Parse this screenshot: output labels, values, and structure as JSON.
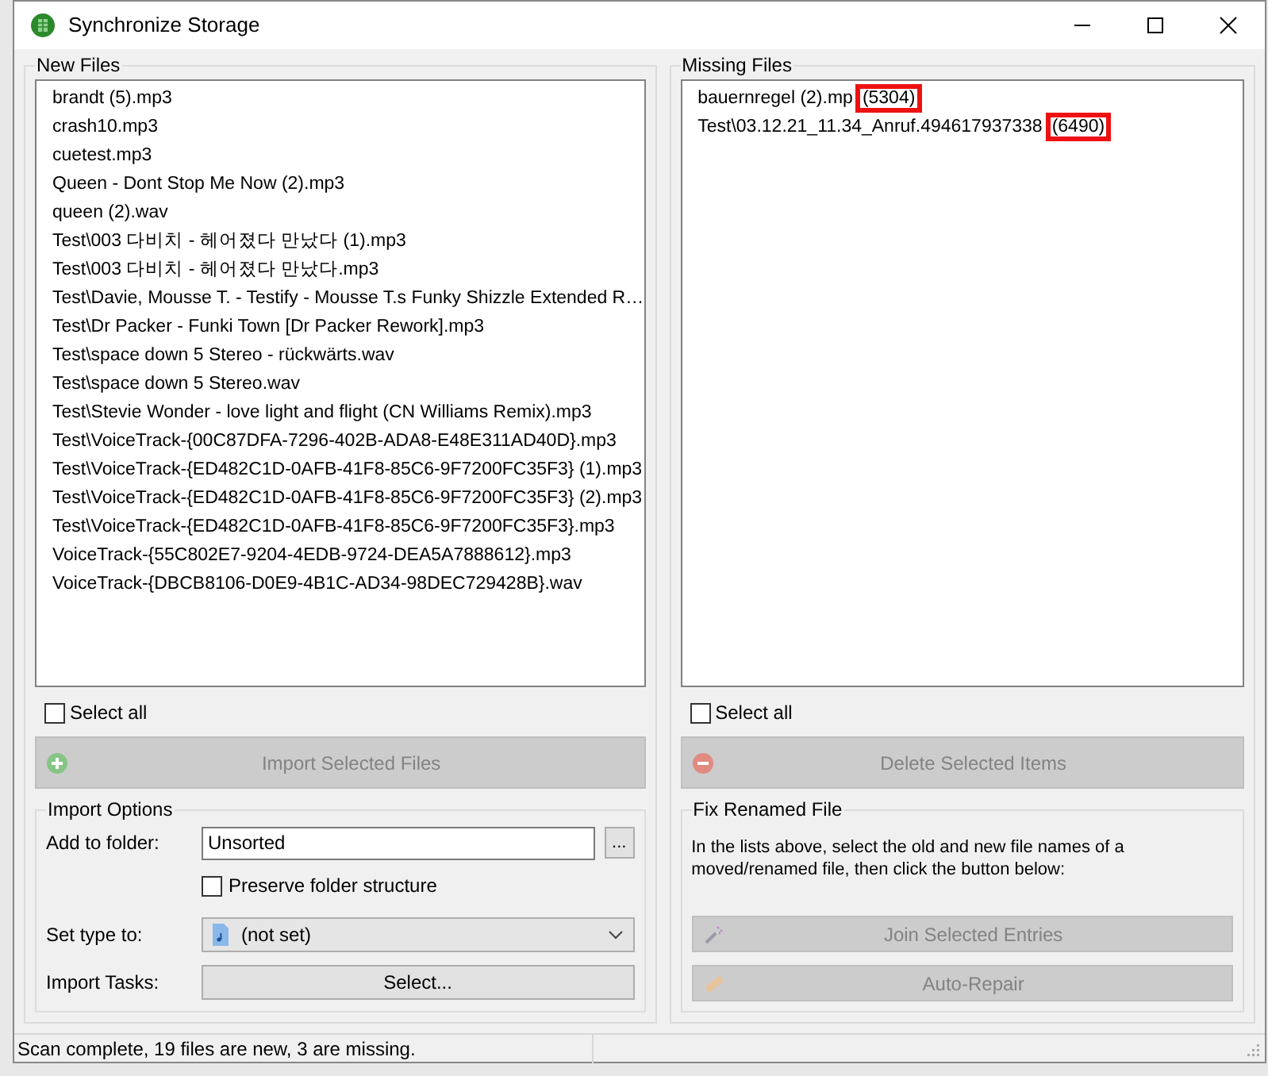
{
  "window": {
    "title": "Synchronize Storage"
  },
  "new_files": {
    "title": "New Files",
    "items": [
      "brandt (5).mp3",
      "crash10.mp3",
      "cuetest.mp3",
      "Queen - Dont Stop Me Now (2).mp3",
      "queen (2).wav",
      "Test\\003 다비치 - 헤어졌다 만났다 (1).mp3",
      "Test\\003 다비치 - 헤어졌다 만났다.mp3",
      "Test\\Davie, Mousse T. - Testify - Mousse T.s Funky Shizzle Extended R…",
      "Test\\Dr Packer - Funki Town [Dr Packer Rework].mp3",
      "Test\\space down 5 Stereo - rückwärts.wav",
      "Test\\space down 5 Stereo.wav",
      "Test\\Stevie Wonder - love light and flight (CN Williams Remix).mp3",
      "Test\\VoiceTrack-{00C87DFA-7296-402B-ADA8-E48E311AD40D}.mp3",
      "Test\\VoiceTrack-{ED482C1D-0AFB-41F8-85C6-9F7200FC35F3} (1).mp3",
      "Test\\VoiceTrack-{ED482C1D-0AFB-41F8-85C6-9F7200FC35F3} (2).mp3",
      "Test\\VoiceTrack-{ED482C1D-0AFB-41F8-85C6-9F7200FC35F3}.mp3",
      "VoiceTrack-{55C802E7-9204-4EDB-9724-DEA5A7888612}.mp3",
      "VoiceTrack-{DBCB8106-D0E9-4B1C-AD34-98DEC729428B}.wav"
    ],
    "select_all": {
      "label": "Select all",
      "checked": false
    },
    "action": {
      "label": "Import Selected Files",
      "kind": "add",
      "disabled": true
    }
  },
  "import_options": {
    "title": "Import Options",
    "folder": {
      "label": "Add to folder:",
      "value": "Unsorted",
      "browse": "..."
    },
    "preserve": {
      "label": "Preserve folder structure",
      "checked": false
    },
    "type": {
      "label": "Set type to:",
      "value": "(not set)"
    },
    "tasks": {
      "label": "Import Tasks:",
      "button": "Select..."
    }
  },
  "missing_files": {
    "title": "Missing Files",
    "items": [
      {
        "name": "bauernregel (2).mp",
        "tag": "(5304)",
        "highlighted": true
      },
      {
        "name": "Test\\03.12.21_11.34_Anruf.494617937338",
        "tag": "(6490)",
        "highlighted": true
      }
    ],
    "select_all": {
      "label": "Select all",
      "checked": false
    },
    "action": {
      "label": "Delete Selected Items",
      "kind": "remove",
      "disabled": true
    }
  },
  "fix_renamed": {
    "title": "Fix Renamed File",
    "hint": "In the lists above, select the old and new file names of a moved/renamed file, then click the button below:",
    "buttons": [
      {
        "label": "Join Selected Entries",
        "kind": "join",
        "disabled": true
      },
      {
        "label": "Auto-Repair",
        "kind": "repair",
        "disabled": true
      }
    ]
  },
  "status_bar": {
    "text": "Scan complete, 19 files are new, 3 are missing."
  }
}
